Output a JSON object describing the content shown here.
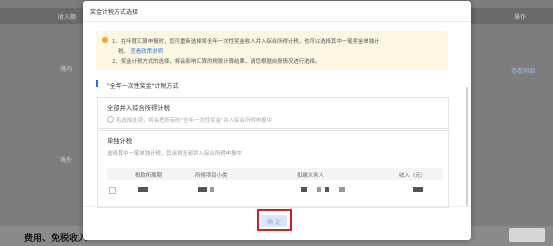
{
  "background": {
    "col_income": "收入额",
    "col_action": "操作",
    "row1_label": "境内",
    "row2_label": "境外",
    "action_link": "查看明细",
    "bottom_text": "费用、免税收入"
  },
  "modal": {
    "title": "奖金计税方式选择",
    "notice": {
      "line1": "1、在年度汇算申报时，您可重新选择将全年一次性奖金收入并入综合所得计税，也可以选择其中一笔奖金单独计",
      "line2a": "税。",
      "line2_link": "查看政策说明",
      "line3": "2、奖金计税方式的选择，将会影响汇算的税款计算结果，请您根据自身情况进行选择。"
    },
    "section_title": "\"全年一次性奖金\"计税方式",
    "option_merge": {
      "title": "全部并入综合所得计税",
      "desc": "若选择此项，将会把所有的\"全年一次性奖金\"并入综合所得申报中"
    },
    "option_single": {
      "title": "单独计税",
      "desc": "选择其中一笔单独计税，其余将全部并入综合所得申报中"
    },
    "table": {
      "columns": [
        "税款所属期",
        "所得项目小类",
        "扣缴义务人",
        "收入（元）"
      ]
    },
    "confirm_label": "确 定"
  },
  "colors": {
    "highlight": "#d71f1f",
    "link": "#3a7bd5",
    "notice_bg": "#fdf6e3",
    "warn": "#f5a623"
  }
}
